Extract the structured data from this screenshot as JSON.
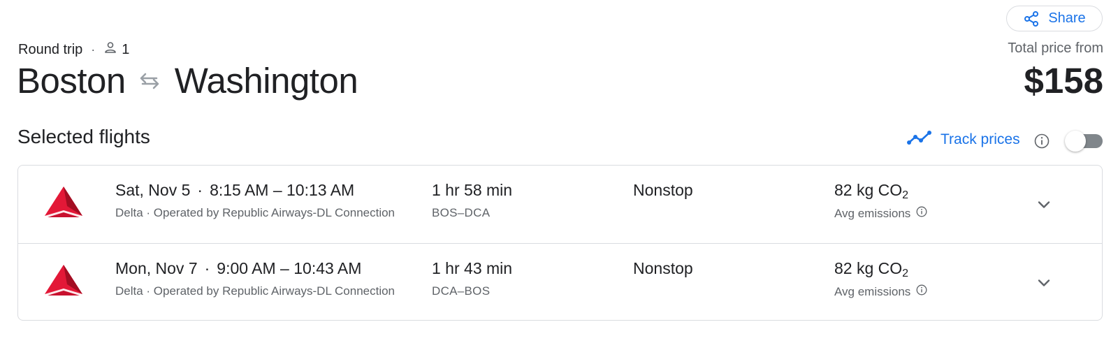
{
  "share": {
    "label": "Share",
    "icon": "share-icon"
  },
  "trip": {
    "type": "Round trip",
    "separator": "·",
    "passengers": "1",
    "origin": "Boston",
    "destination": "Washington"
  },
  "price": {
    "label": "Total price from",
    "amount": "$158"
  },
  "section": {
    "title": "Selected flights",
    "track_label": "Track prices",
    "track_enabled": false
  },
  "colors": {
    "accent": "#1a73e8",
    "delta_red": "#c8102e",
    "border": "#dadce0",
    "secondary_text": "#5f6368"
  },
  "flights": [
    {
      "airline_logo": "delta-logo",
      "date": "Sat, Nov 5",
      "dot": "·",
      "times": "8:15 AM – 10:13 AM",
      "airline_info": "Delta · Operated by Republic Airways-DL Connection",
      "duration": "1 hr 58 min",
      "airports": "BOS–DCA",
      "stops": "Nonstop",
      "emissions_value": "82 kg CO",
      "emissions_sub": "2",
      "emissions_label": "Avg emissions"
    },
    {
      "airline_logo": "delta-logo",
      "date": "Mon, Nov 7",
      "dot": "·",
      "times": "9:00 AM – 10:43 AM",
      "airline_info": "Delta · Operated by Republic Airways-DL Connection",
      "duration": "1 hr 43 min",
      "airports": "DCA–BOS",
      "stops": "Nonstop",
      "emissions_value": "82 kg CO",
      "emissions_sub": "2",
      "emissions_label": "Avg emissions"
    }
  ]
}
